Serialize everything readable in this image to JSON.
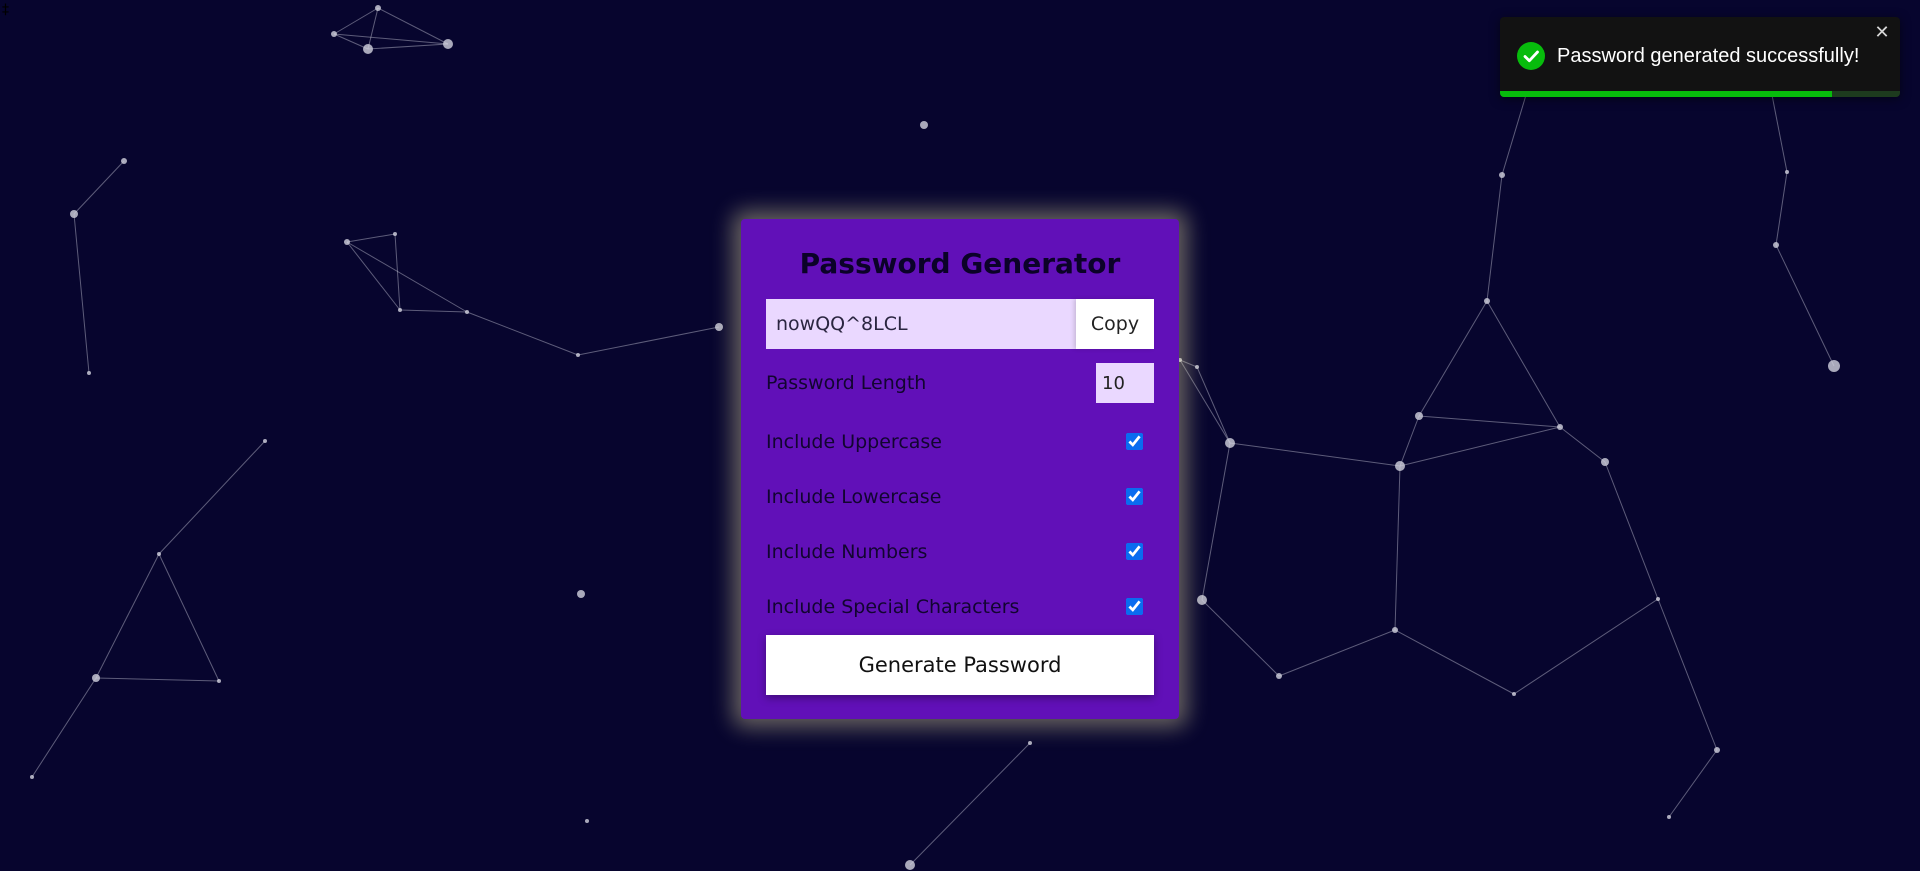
{
  "page": {
    "corner_glyph": "‡"
  },
  "card": {
    "title": "Password Generator",
    "password_value": "nowQQ^8LCL",
    "copy_label": "Copy",
    "length_label": "Password Length",
    "length_value": "10",
    "options": [
      {
        "label": "Include Uppercase",
        "checked": true
      },
      {
        "label": "Include Lowercase",
        "checked": true
      },
      {
        "label": "Include Numbers",
        "checked": true
      },
      {
        "label": "Include Special Characters",
        "checked": true
      }
    ],
    "generate_label": "Generate Password"
  },
  "toast": {
    "message": "Password generated successfully!",
    "close_glyph": "✕",
    "icon": "check-circle-icon",
    "progress": 0.83,
    "accent_color": "#07bc0c"
  },
  "colors": {
    "background": "#07052e",
    "card": "#6110b8",
    "input_bg": "#ead8ff",
    "checkbox": "#0a6cf0"
  }
}
